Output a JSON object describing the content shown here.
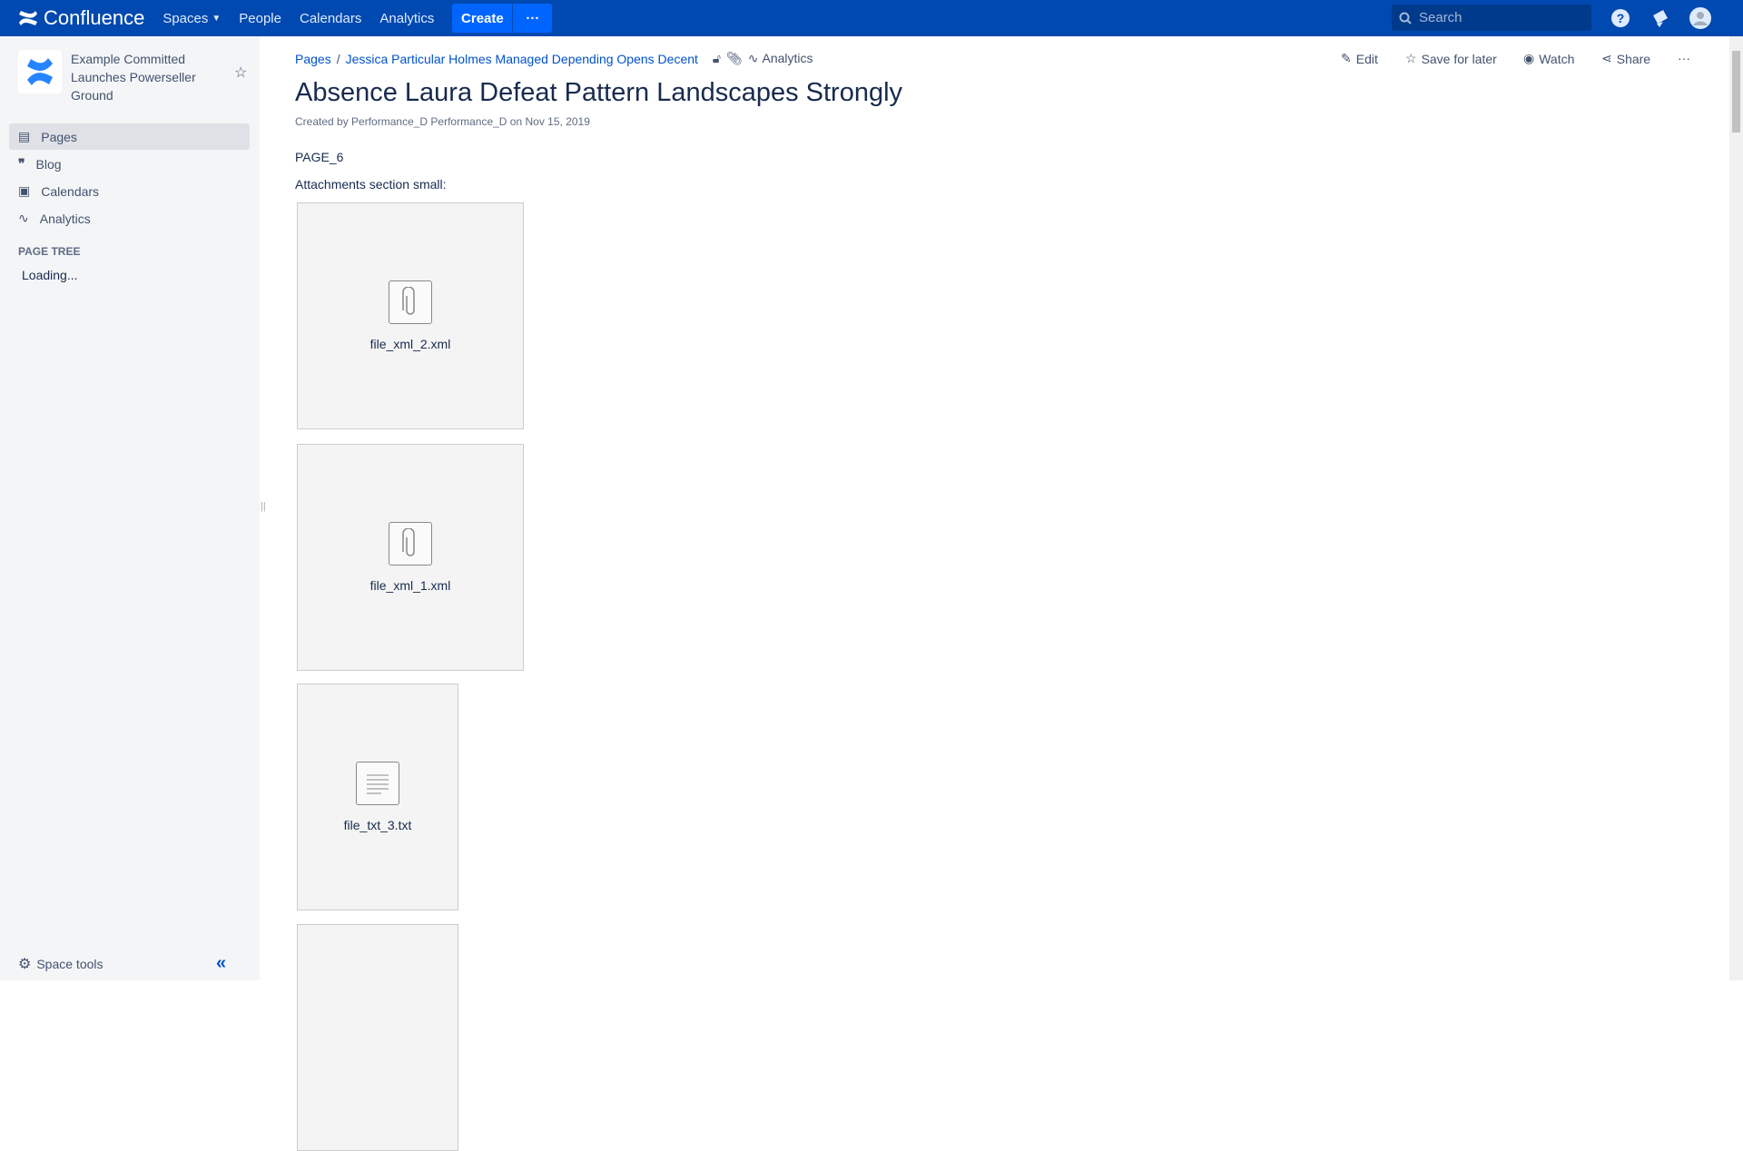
{
  "topbar": {
    "product": "Confluence",
    "nav": [
      "Spaces",
      "People",
      "Calendars",
      "Analytics"
    ],
    "create_label": "Create",
    "more_label": "···",
    "search_placeholder": "Search"
  },
  "sidebar": {
    "space_name": "Example Committed Launches Powerseller Ground",
    "items": [
      {
        "label": "Pages",
        "icon": "page-icon",
        "active": true
      },
      {
        "label": "Blog",
        "icon": "quote-icon"
      },
      {
        "label": "Calendars",
        "icon": "calendar-icon"
      },
      {
        "label": "Analytics",
        "icon": "analytics-icon"
      }
    ],
    "page_tree_label": "PAGE TREE",
    "loading": "Loading...",
    "space_tools": "Space tools"
  },
  "breadcrumb": {
    "root": "Pages",
    "parent": "Jessica Particular Holmes Managed Depending Opens Decent",
    "analytics": "Analytics"
  },
  "actions": {
    "edit": "Edit",
    "save": "Save for later",
    "watch": "Watch",
    "share": "Share"
  },
  "page": {
    "title": "Absence Laura Defeat Pattern Landscapes Strongly",
    "meta_prefix": "Created by",
    "author": "Performance_D Performance_D",
    "meta_on": "on",
    "date": "Nov 15, 2019",
    "body": "PAGE_6",
    "attachments_label": "Attachments section small:",
    "attachments": [
      {
        "name": "file_xml_2.xml",
        "icon": "paperclip-icon"
      },
      {
        "name": "file_xml_1.xml",
        "icon": "paperclip-icon"
      },
      {
        "name": "file_txt_3.txt",
        "icon": "text-file-icon"
      },
      {
        "name": "",
        "icon": ""
      }
    ]
  },
  "colors": {
    "header": "#0049b0",
    "accent": "#0065ff",
    "link": "#0052cc"
  }
}
